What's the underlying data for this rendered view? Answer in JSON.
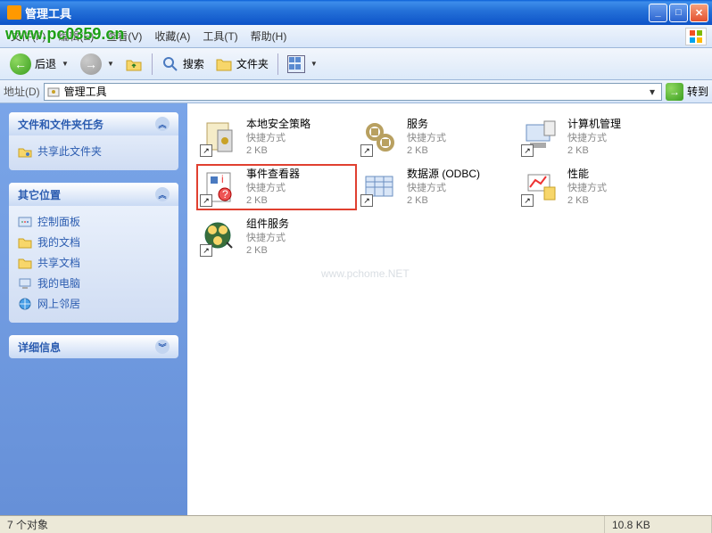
{
  "window": {
    "title": "管理工具"
  },
  "menu": {
    "file": "文件(F)",
    "edit": "编辑(E)",
    "view": "查看(V)",
    "favorites": "收藏(A)",
    "tools": "工具(T)",
    "help": "帮助(H)"
  },
  "toolbar": {
    "back": "后退",
    "search": "搜索",
    "folders": "文件夹"
  },
  "address": {
    "label": "地址(D)",
    "value": "管理工具",
    "go": "转到"
  },
  "sidebar": {
    "tasks": {
      "title": "文件和文件夹任务",
      "items": [
        "共享此文件夹"
      ]
    },
    "places": {
      "title": "其它位置",
      "items": [
        "控制面板",
        "我的文档",
        "共享文档",
        "我的电脑",
        "网上邻居"
      ]
    },
    "details": {
      "title": "详细信息"
    }
  },
  "items": [
    {
      "name": "本地安全策略",
      "type": "快捷方式",
      "size": "2 KB"
    },
    {
      "name": "服务",
      "type": "快捷方式",
      "size": "2 KB"
    },
    {
      "name": "计算机管理",
      "type": "快捷方式",
      "size": "2 KB"
    },
    {
      "name": "事件查看器",
      "type": "快捷方式",
      "size": "2 KB",
      "selected": true
    },
    {
      "name": "数据源 (ODBC)",
      "type": "快捷方式",
      "size": "2 KB"
    },
    {
      "name": "性能",
      "type": "快捷方式",
      "size": "2 KB"
    },
    {
      "name": "组件服务",
      "type": "快捷方式",
      "size": "2 KB"
    }
  ],
  "status": {
    "count": "7 个对象",
    "size": "10.8 KB"
  },
  "watermark": {
    "url": "www.pc0359.cn",
    "mid": "www.pchome.NET"
  }
}
